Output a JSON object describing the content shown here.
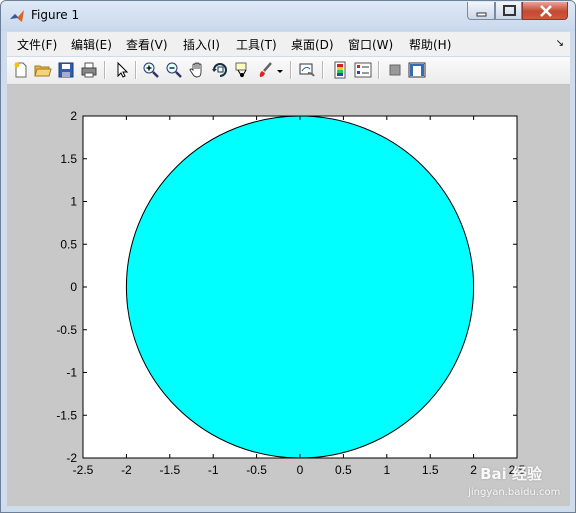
{
  "window": {
    "title": "Figure 1"
  },
  "menu": [
    {
      "label": "文件(F)"
    },
    {
      "label": "编辑(E)"
    },
    {
      "label": "查看(V)"
    },
    {
      "label": "插入(I)"
    },
    {
      "label": "工具(T)"
    },
    {
      "label": "桌面(D)"
    },
    {
      "label": "窗口(W)"
    },
    {
      "label": "帮助(H)"
    }
  ],
  "toolbar": [
    "new-figure-icon",
    "open-file-icon",
    "save-icon",
    "print-icon",
    "select-arrow-icon",
    "zoom-in-icon",
    "zoom-out-icon",
    "pan-hand-icon",
    "rotate-3d-icon",
    "data-cursor-icon",
    "brush-icon",
    "link-plot-icon",
    "colorbar-icon",
    "legend-icon",
    "hide-plot-tools-icon",
    "show-plot-tools-icon"
  ],
  "chart_data": {
    "type": "area",
    "shape": "filled circle",
    "center": [
      0,
      0
    ],
    "radius": 2,
    "fill_color": "#00ffff",
    "edge_color": "#000000",
    "xlim": [
      -2.5,
      2.5
    ],
    "ylim": [
      -2,
      2
    ],
    "xticks": [
      "-2.5",
      "-2",
      "-1.5",
      "-1",
      "-0.5",
      "0",
      "0.5",
      "1",
      "1.5",
      "2",
      "2.5"
    ],
    "yticks": [
      "2",
      "1.5",
      "1",
      "0.5",
      "0",
      "-0.5",
      "-1",
      "-1.5",
      "-2"
    ],
    "grid": false
  },
  "watermark": {
    "main": "Bai 经验",
    "sub": "jingyan.baidu.com"
  }
}
